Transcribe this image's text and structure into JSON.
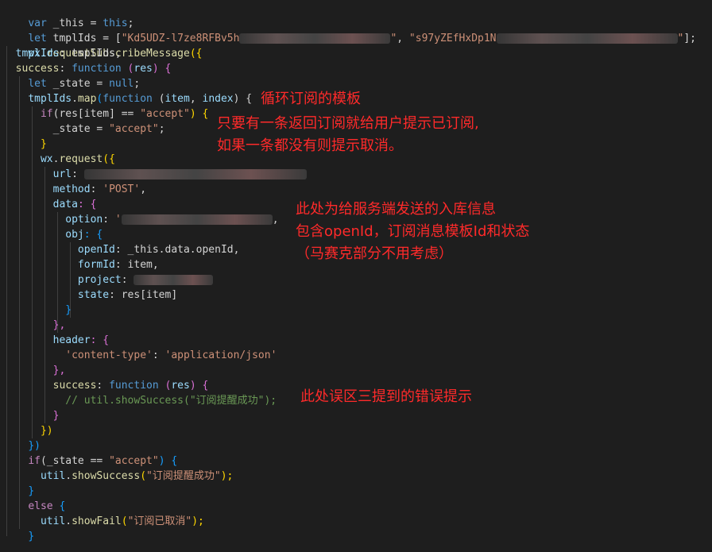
{
  "code": {
    "l1": {
      "a": "var",
      "b": " _this = ",
      "c": "this",
      "d": ";"
    },
    "l2": {
      "a": "let",
      "b": " tmplIds = [",
      "c": "\"Kd5UDZ-l7ze8RFBv5h",
      "d": "\"",
      "e": ", ",
      "f": "\"s97yZEfHxDp1N",
      "g": "\"",
      "h": "];"
    },
    "l3": {
      "a": "wx",
      "b": ".",
      "c": "requestSubscribeMessage",
      "d": "({"
    },
    "l4": {
      "a": "tmplIds",
      "b": ": tmplIds,"
    },
    "l5": {
      "a": "success",
      "b": ": ",
      "c": "function",
      "d": " (",
      "e": "res",
      "f": ") {"
    },
    "l6": {
      "a": "let",
      "b": " _state = ",
      "c": "null",
      "d": ";"
    },
    "l7": {
      "a": "tmplIds",
      "b": ".",
      "c": "map",
      "d": "(",
      "e": "function",
      "f": " (",
      "g": "item",
      "h": ", ",
      "i": "index",
      "j": ") {"
    },
    "l8": {
      "a": "if",
      "b": "(res[item] == ",
      "c": "\"accept\"",
      "d": ") {"
    },
    "l9": {
      "a": "_state = ",
      "b": "\"accept\"",
      "c": ";"
    },
    "l10": {
      "a": "}"
    },
    "l11": {
      "a": "wx",
      "b": ".",
      "c": "request",
      "d": "({"
    },
    "l12": {
      "a": "url",
      "b": ": "
    },
    "l13": {
      "a": "method",
      "b": ": ",
      "c": "'POST'",
      "d": ","
    },
    "l14": {
      "a": "data",
      "b": ": {"
    },
    "l15": {
      "a": "option",
      "b": ": ",
      "c": "'",
      "d": ","
    },
    "l16": {
      "a": "obj",
      "b": ": {"
    },
    "l17": {
      "a": "openId",
      "b": ": _this.data.openId,"
    },
    "l18": {
      "a": "formId",
      "b": ": item,"
    },
    "l19": {
      "a": "project",
      "b": ": "
    },
    "l20": {
      "a": "state",
      "b": ": res[item]"
    },
    "l21": {
      "a": "}"
    },
    "l22": {
      "a": "},"
    },
    "l23": {
      "a": "header",
      "b": ": {"
    },
    "l24": {
      "a": "'content-type'",
      "b": ": ",
      "c": "'application/json'"
    },
    "l25": {
      "a": "},"
    },
    "l26": {
      "a": "success",
      "b": ": ",
      "c": "function",
      "d": " (",
      "e": "res",
      "f": ") {"
    },
    "l27": {
      "a": "// util.showSuccess(\"订阅提醒成功\");"
    },
    "l28": {
      "a": "}"
    },
    "l29": {
      "a": "})"
    },
    "l30": {
      "a": "})"
    },
    "l31": {
      "a": "if",
      "b": "(_state == ",
      "c": "\"accept\"",
      "d": ") {"
    },
    "l32": {
      "a": "util",
      "b": ".",
      "c": "showSuccess",
      "d": "(",
      "e": "\"订阅提醒成功\"",
      "f": ");"
    },
    "l33": {
      "a": "}"
    },
    "l34": {
      "a": "else",
      "b": " {"
    },
    "l35": {
      "a": "util",
      "b": ".",
      "c": "showFail",
      "d": "(",
      "e": "\"订阅已取消\"",
      "f": ");"
    },
    "l36": {
      "a": "}"
    }
  },
  "annotations": {
    "note1": "循环订阅的模板",
    "note2a": "只要有一条返回订阅就给用户提示已订阅,",
    "note2b": "如果一条都没有则提示取消。",
    "note3a": "此处为给服务端发送的入库信息",
    "note3b": "包含openId，订阅消息模板Id和状态",
    "note3c": "（马赛克部分不用考虑）",
    "note4": "此处误区三提到的错误提示"
  },
  "colors": {
    "background": "#1e1e1e",
    "annotation": "#ff2a2a"
  }
}
